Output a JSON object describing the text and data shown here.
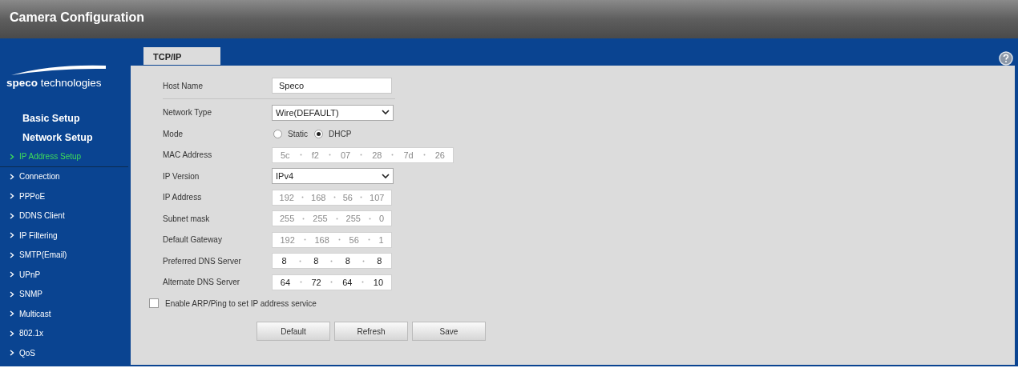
{
  "window": {
    "title": "Camera Configuration"
  },
  "logo": {
    "text": "**speco** technologies"
  },
  "sidebar": {
    "sections": [
      {
        "label": "Basic Setup"
      },
      {
        "label": "Network Setup",
        "items": [
          {
            "label": "IP Address Setup",
            "selected": true
          },
          {
            "label": "Connection",
            "selected": false
          },
          {
            "label": "PPPoE",
            "selected": false
          },
          {
            "label": "DDNS Client",
            "selected": false
          },
          {
            "label": "IP Filtering",
            "selected": false
          },
          {
            "label": "SMTP(Email)",
            "selected": false
          },
          {
            "label": "UPnP",
            "selected": false
          },
          {
            "label": "SNMP",
            "selected": false
          },
          {
            "label": "Multicast",
            "selected": false
          },
          {
            "label": "802.1x",
            "selected": false
          },
          {
            "label": "QoS",
            "selected": false
          }
        ]
      }
    ]
  },
  "tabs": [
    {
      "label": "TCP/IP",
      "selected": true
    }
  ],
  "form": {
    "fields": [
      {
        "kind": "text",
        "label": "Host Name",
        "value": "Speco"
      },
      {
        "kind": "select",
        "label": "Network Type",
        "value": "Wire(DEFAULT)"
      },
      {
        "kind": "radio",
        "label": "Mode",
        "options": [
          {
            "label": "Static",
            "selected": false
          },
          {
            "label": "DHCP",
            "selected": true
          }
        ]
      },
      {
        "kind": "mac",
        "label": "MAC Address",
        "parts": [
          "5c",
          "f2",
          "07",
          "28",
          "7d",
          "26"
        ],
        "disabled": true
      },
      {
        "kind": "select",
        "label": "IP Version",
        "value": "IPv4"
      },
      {
        "kind": "ip",
        "label": "IP Address",
        "parts": [
          "192",
          "168",
          "56",
          "107"
        ],
        "disabled": true
      },
      {
        "kind": "ip",
        "label": "Subnet mask",
        "parts": [
          "255",
          "255",
          "255",
          "0"
        ],
        "disabled": true
      },
      {
        "kind": "ip",
        "label": "Default Gateway",
        "parts": [
          "192",
          "168",
          "56",
          "1"
        ],
        "disabled": true
      },
      {
        "kind": "ip",
        "label": "Preferred DNS Server",
        "parts": [
          "8",
          "8",
          "8",
          "8"
        ],
        "disabled": false
      },
      {
        "kind": "ip",
        "label": "Alternate DNS Server",
        "parts": [
          "64",
          "72",
          "64",
          "10"
        ],
        "disabled": false
      }
    ],
    "checkbox": {
      "label": "Enable ARP/Ping to set IP address service",
      "checked": false
    },
    "buttons": [
      "Default",
      "Refresh",
      "Save"
    ]
  }
}
